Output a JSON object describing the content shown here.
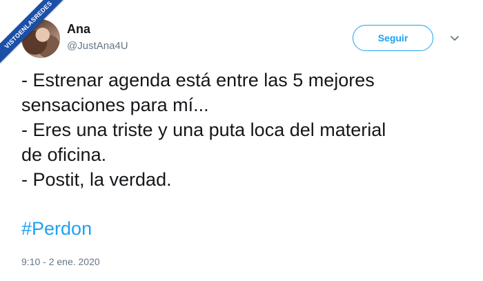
{
  "user": {
    "name": "Ana",
    "handle": "@JustAna4U"
  },
  "actions": {
    "follow_label": "Seguir",
    "more_icon": "chevron-down-icon"
  },
  "tweet": {
    "lines": [
      "- Estrenar agenda está entre las 5 mejores",
      "sensaciones para mí...",
      "- Eres una triste y una puta loca del material",
      "de oficina.",
      "- Postit, la verdad."
    ],
    "hashtag": "#Perdon",
    "timestamp": "9:10 - 2 ene. 2020"
  },
  "watermark": {
    "text": "VISTOENLASREDES"
  },
  "colors": {
    "accent": "#1da1f2",
    "text": "#14171a",
    "secondary": "#657786",
    "ribbon": "#1b4fa8"
  }
}
